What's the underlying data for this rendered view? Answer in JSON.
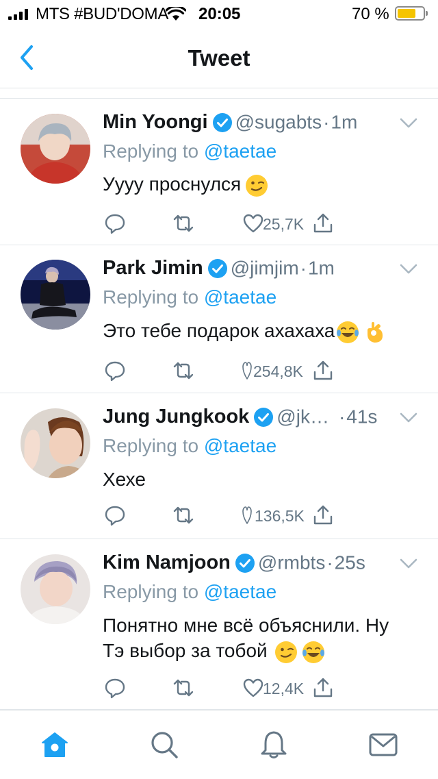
{
  "status_bar": {
    "carrier": "MTS #BUD'DOMA",
    "time": "20:05",
    "battery": "70 %",
    "battery_level": 0.7
  },
  "nav": {
    "title": "Tweet",
    "back_icon": "chevron-left-icon"
  },
  "colors": {
    "accent": "#1da1f2",
    "secondary": "#657786",
    "text": "#14171a"
  },
  "tweets": [
    {
      "name": "Min Yoongi",
      "handle": "@sugabts",
      "sep": "·",
      "time": "1m",
      "reply_prefix": "Replying to",
      "reply_to": "@taetae",
      "text": "Уууу проснулся",
      "emoji": [
        "wink-emoji"
      ],
      "likes": "25,7K"
    },
    {
      "name": "Park Jimin",
      "handle": "@jimjim",
      "sep": "·",
      "time": "1m",
      "reply_prefix": "Replying to",
      "reply_to": "@taetae",
      "text": "Это тебе подарок ахахаха",
      "emoji": [
        "laughing-tears-emoji",
        "ok-hand-emoji"
      ],
      "likes": "254,8K"
    },
    {
      "name": "Jung Jungkook",
      "handle": "@jk…",
      "sep": "·",
      "time": "41s",
      "reply_prefix": "Replying to",
      "reply_to": "@taetae",
      "text": "Хехе",
      "emoji": [],
      "likes": "136,5K"
    },
    {
      "name": "Kim Namjoon",
      "handle": "@rmbts",
      "sep": "·",
      "time": "25s",
      "reply_prefix": "Replying to",
      "reply_to": "@taetae",
      "text_line1": "Понятно мне всё объяснили. Ну",
      "text_line2": "Тэ выбор за тобой",
      "emoji": [
        "wink-emoji",
        "laughing-tears-emoji"
      ],
      "likes": "12,4K"
    }
  ],
  "tab_bar": {
    "items": [
      "home-icon",
      "search-icon",
      "notifications-icon",
      "messages-icon"
    ],
    "active": "home-icon"
  }
}
